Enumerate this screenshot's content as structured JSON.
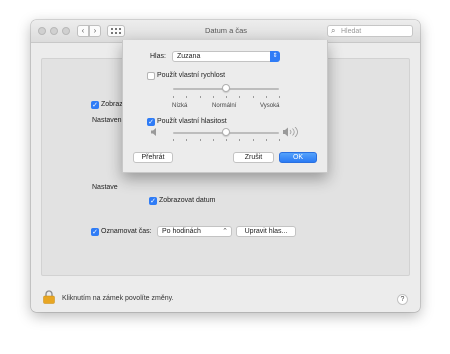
{
  "window": {
    "title": "Datum a čas",
    "search_placeholder": "Hledat"
  },
  "background": {
    "show_clock_partial": "Zobraz",
    "settings_label_1": "Nastaven",
    "settings_label_2": "Nastave",
    "show_date": "Zobrazovat datum",
    "announce_time_label": "Oznamovat čas:",
    "announce_time_value": "Po hodinách",
    "customize_voice_button": "Upravit hlas..."
  },
  "footer": {
    "lock_text": "Kliknutím na zámek povolíte změny.",
    "help": "?"
  },
  "sheet": {
    "voice_label": "Hlas:",
    "voice_value": "Zuzana",
    "custom_rate_label": "Použít vlastní rychlost",
    "custom_rate_checked": false,
    "rate_labels": [
      "Nízká",
      "Normální",
      "Vysoká"
    ],
    "rate_value": 0.5,
    "custom_volume_label": "Použít vlastní hlasitost",
    "custom_volume_checked": true,
    "volume_value": 0.5,
    "play_button": "Přehrát",
    "cancel_button": "Zrušit",
    "ok_button": "OK"
  },
  "colors": {
    "accent": "#2f7cf6"
  }
}
